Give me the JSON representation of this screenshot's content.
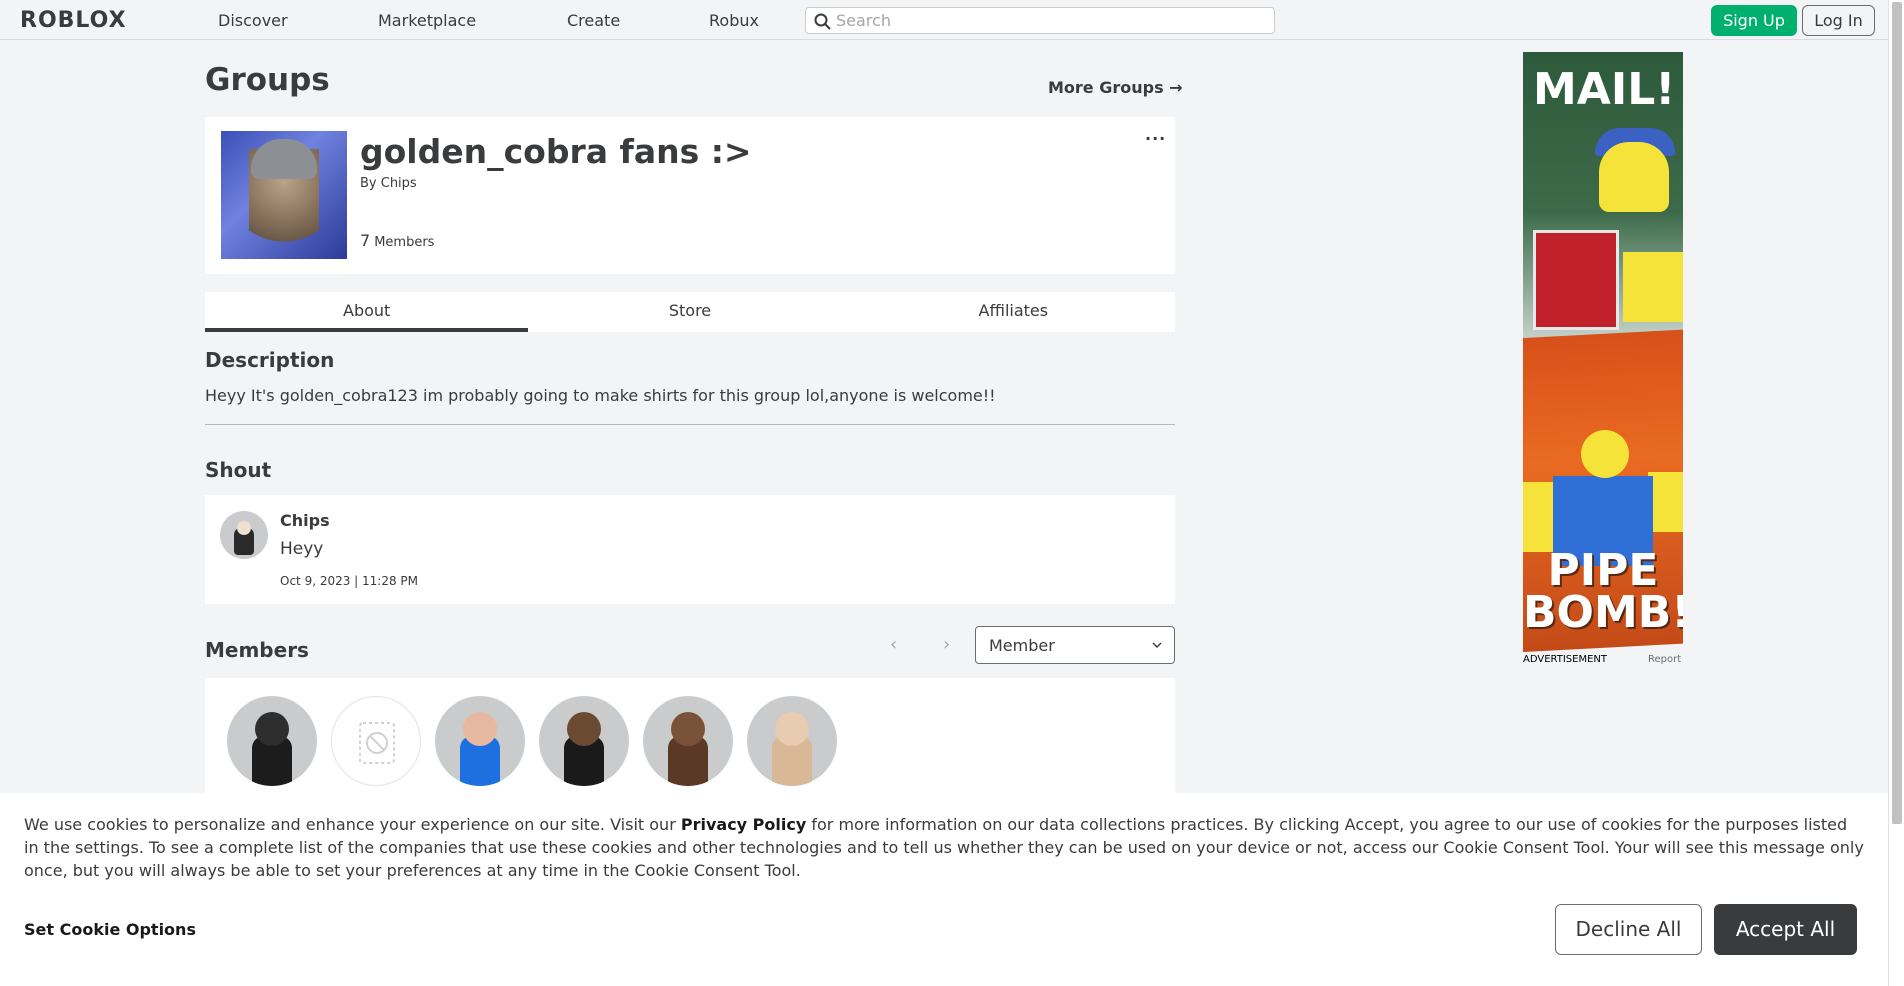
{
  "nav": {
    "logo": "ROBLOX",
    "links": [
      "Discover",
      "Marketplace",
      "Create",
      "Robux"
    ],
    "search_placeholder": "Search",
    "signup": "Sign Up",
    "login": "Log In"
  },
  "page": {
    "title": "Groups",
    "more_groups": "More Groups →"
  },
  "group": {
    "name": "golden_cobra fans :>",
    "by": "By Chips",
    "member_count": "7",
    "member_label": "Members",
    "more_menu": "..."
  },
  "tabs": [
    {
      "label": "About",
      "active": true
    },
    {
      "label": "Store",
      "active": false
    },
    {
      "label": "Affiliates",
      "active": false
    }
  ],
  "about": {
    "description_title": "Description",
    "description": "Heyy It's golden_cobra123 im probably going to make shirts for this group lol,anyone is welcome!!",
    "shout_title": "Shout",
    "shout": {
      "user": "Chips",
      "body": "Heyy",
      "date": "Oct 9, 2023 | 11:28 PM"
    },
    "members_title": "Members",
    "role_select": "Member",
    "pager_prev": "‹",
    "pager_next": "›"
  },
  "ad": {
    "headline_top": "MAIL!",
    "headline_bottom": "PIPE BOMB!",
    "label": "ADVERTISEMENT",
    "report": "Report"
  },
  "cookie": {
    "text_before": "We use cookies to personalize and enhance your experience on our site. Visit our ",
    "privacy_link": "Privacy Policy",
    "text_after": " for more information on our data collections practices. By clicking Accept, you agree to our use of cookies for the purposes listed in the settings. To see a complete list of the companies that use these cookies and other technologies and to tell us whether they can be used on your device or not, access our Cookie Consent Tool. Your will see this message only once, but you will always be able to set your preferences at any time in the Cookie Consent Tool.",
    "set_options": "Set Cookie Options",
    "decline": "Decline All",
    "accept": "Accept All"
  },
  "colors": {
    "signup_green": "#00b06f",
    "accept_dark": "#393b3d",
    "background": "#f2f4f5"
  }
}
